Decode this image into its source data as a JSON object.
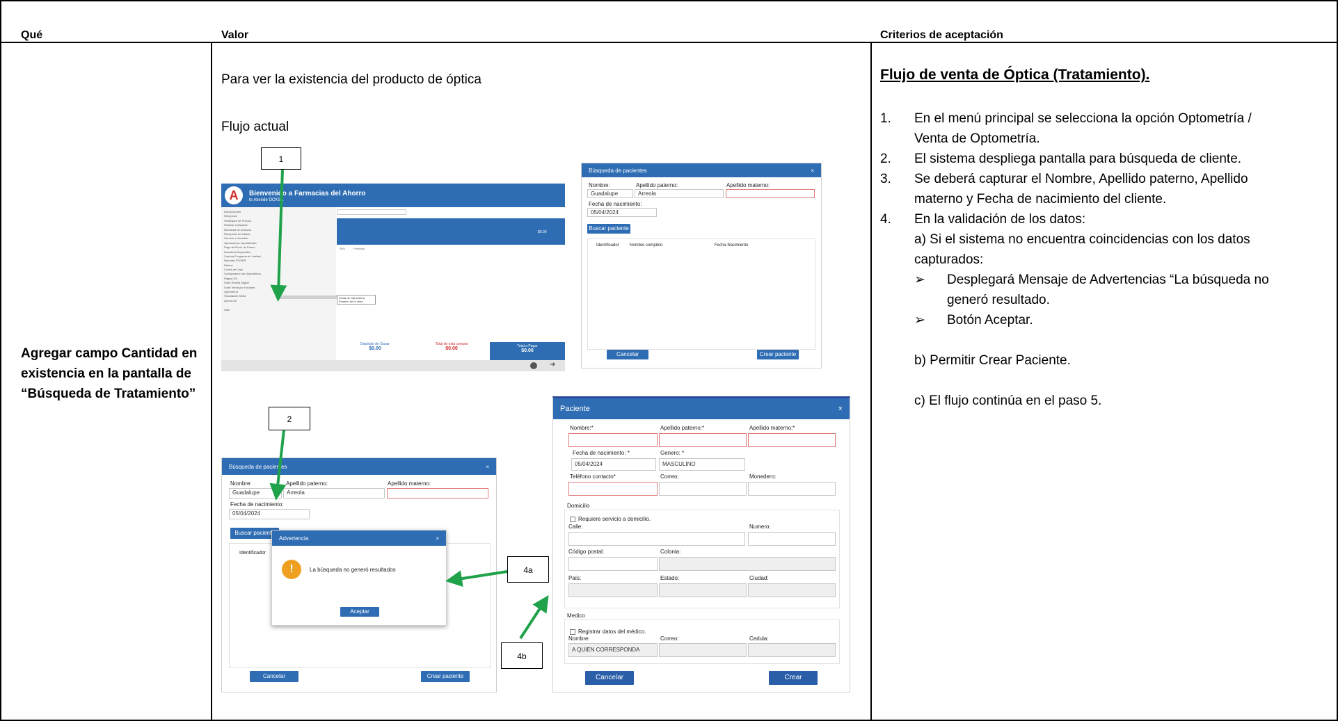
{
  "headers": {
    "que": "Qué",
    "valor": "Valor",
    "criterios": "Criterios de aceptación"
  },
  "que_text": "Agregar campo Cantidad en existencia en la pantalla de “Búsqueda de Tratamiento”",
  "valor": {
    "line1": "Para ver la existencia del producto de óptica",
    "line2": "Flujo actual"
  },
  "callouts": {
    "c1": "1",
    "c2": "2",
    "c4a": "4a",
    "c4b": "4b"
  },
  "main_app": {
    "title": "Bienvenido a Farmacias del Ahorro",
    "subtitle": "te Atiende OCKSA",
    "menu": [
      "Devoluciones",
      "Recepción",
      "Verificador de Precios",
      "Realizar Cotización",
      "Demanda de Artículos",
      "Recepción de traslos",
      "Servicio a domicilio",
      "Operaciones Impostérales",
      "Pago de Envío de Dinero",
      "Donativos Especiales",
      "Captura Programa de Lealtad",
      "Reportes POSER",
      "Retiros",
      "Cortes de Caja",
      "Configuración de Dispositivos",
      "Pagos CIE",
      "Surtir Receta Digital",
      "Surtir Venta por Volumen",
      "Optometría",
      "Vinculación MDM",
      "Acerca de",
      "",
      "Salir"
    ],
    "submenu": [
      "Venta de Optometría",
      "Examen de la Vista"
    ],
    "total_top": "$0.00",
    "col_sku": "SKU",
    "col_producto": "Producto",
    "dep_label": "Depósito de Ganar",
    "dep_value": "$0.00",
    "compra_label": "Total de esta compra",
    "compra_value": "$0.00",
    "pagar_label": "Total a Pagar",
    "pagar_value": "$0.00"
  },
  "busqueda": {
    "title": "Búsqueda de pacientes",
    "close": "×",
    "nombre_label": "Nombre:",
    "paterno_label": "Apellido paterno:",
    "materno_label": "Apellido materno:",
    "nombre_value": "Guadalupe",
    "paterno_value": "Arreola",
    "fecha_label": "Fecha de nacimiento:",
    "fecha_value": "05/04/2024",
    "buscar": "Buscar paciente",
    "col_id": "Identificador",
    "col_nombre": "Nombre completo",
    "col_fecha": "Fecha Nacimiento",
    "cancelar": "Cancelar",
    "crear": "Crear paciente"
  },
  "advertencia": {
    "title": "Advertencia",
    "close": "×",
    "message": "La búsqueda no generó resultados",
    "aceptar": "Aceptar"
  },
  "paciente": {
    "title": "Paciente",
    "close": "×",
    "nombre": "Nombre:*",
    "paterno": "Apellido paterno:*",
    "materno": "Apellido materno:*",
    "fecha": "Fecha de nacimiento: *",
    "fecha_value": "05/04/2024",
    "genero": "Genero: *",
    "genero_value": "MASCULINO",
    "telefono": "Teléfono contacto*",
    "correo": "Correo:",
    "monedero": "Monedero:",
    "domicilio": "Domicilio",
    "req_domicilio": "Requiere servicio a domicilio.",
    "calle": "Calle:",
    "numero": "Numero:",
    "cp": "Código postal:",
    "colonia": "Colonia:",
    "pais": "País:",
    "estado": "Estado:",
    "ciudad": "Ciudad:",
    "medico": "Medico",
    "reg_medico": "Registrar datos del médico.",
    "m_nombre": "Nombre:",
    "m_correo": "Correo:",
    "m_cedula": "Cedula:",
    "m_nombre_value": "A QUIEN CORRESPONDA",
    "cancelar": "Cancelar",
    "crear": "Crear"
  },
  "criterios": {
    "title": "Flujo de venta de Óptica (Tratamiento).",
    "items": [
      {
        "n": "1.",
        "lines": [
          "En el menú principal se selecciona la opción Optometría /",
          "Venta de Optometría."
        ]
      },
      {
        "n": "2.",
        "lines": [
          "El sistema despliega pantalla para búsqueda de cliente."
        ]
      },
      {
        "n": "3.",
        "lines": [
          "Se deberá capturar el Nombre, Apellido paterno, Apellido",
          "materno y Fecha de nacimiento del cliente."
        ]
      },
      {
        "n": "4.",
        "lines": [
          "En la validación de los datos:",
          "a) Si el sistema no encuentra coincidencias con los datos",
          "capturados:"
        ]
      }
    ],
    "bullets": [
      [
        "Desplegará Mensaje de Advertencias “La búsqueda no",
        "generó resultado."
      ],
      [
        "Botón Aceptar."
      ]
    ],
    "b": "b) Permitir Crear Paciente.",
    "c": "c) El flujo continúa en el paso 5."
  },
  "colors": {
    "blue": "#2e6db4",
    "red_text": "#d02a2a",
    "green_arrow": "#1fa24a",
    "warn": "#f0a020"
  }
}
